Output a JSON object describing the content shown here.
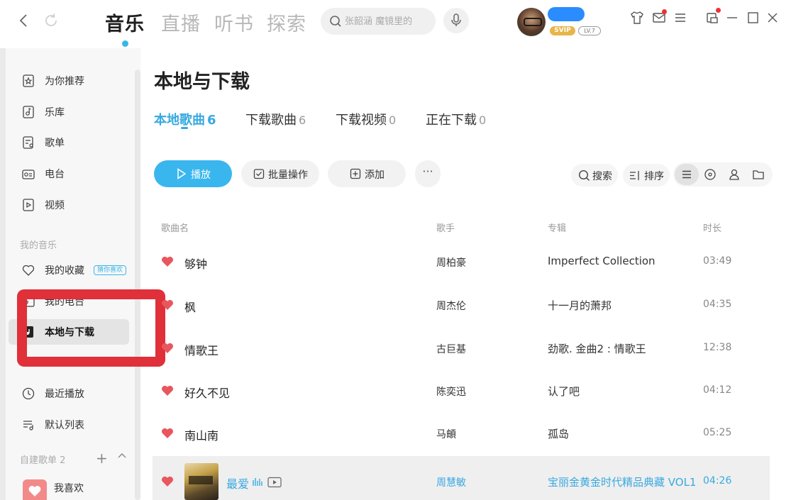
{
  "header": {
    "main_tabs": [
      {
        "label": "音乐",
        "active": true
      },
      {
        "label": "直播",
        "active": false
      },
      {
        "label": "听书",
        "active": false
      },
      {
        "label": "探索",
        "active": false
      }
    ],
    "search": {
      "placeholder": "张韶涵 魔镜里的"
    },
    "user": {
      "vip_badge": "SVIP",
      "level": "LV.7"
    }
  },
  "sidebar": {
    "online_items": [
      {
        "label": "为你推荐",
        "icon": "recommend-icon"
      },
      {
        "label": "乐库",
        "icon": "library-icon"
      },
      {
        "label": "歌单",
        "icon": "playlist-icon"
      },
      {
        "label": "电台",
        "icon": "radio-icon"
      },
      {
        "label": "视频",
        "icon": "video-icon"
      }
    ],
    "my_music_title": "我的音乐",
    "favorites": {
      "label": "我的收藏",
      "badge": "猜你喜欢"
    },
    "my_radio": {
      "label": "我的电台"
    },
    "local_download": {
      "label": "本地与下载"
    },
    "recent": {
      "label": "最近播放"
    },
    "default_list": {
      "label": "默认列表"
    },
    "created_playlists": {
      "label": "自建歌单",
      "count": "2"
    },
    "my_like": {
      "label": "我喜欢"
    }
  },
  "main": {
    "title": "本地与下载",
    "sub_tabs": [
      {
        "label": "本地歌曲",
        "count": "6",
        "active": true
      },
      {
        "label": "下载歌曲",
        "count": "6",
        "active": false
      },
      {
        "label": "下载视频",
        "count": "0",
        "active": false
      },
      {
        "label": "正在下载",
        "count": "0",
        "active": false
      }
    ],
    "actions": {
      "play": "播放",
      "batch": "批量操作",
      "add": "添加",
      "more": "···",
      "search": "搜索",
      "sort": "排序"
    },
    "columns": {
      "song": "歌曲名",
      "artist": "歌手",
      "album": "专辑",
      "duration": "时长"
    },
    "songs": [
      {
        "title": "够钟",
        "artist": "周柏豪",
        "album": "Imperfect Collection",
        "duration": "03:49"
      },
      {
        "title": "枫",
        "artist": "周杰伦",
        "album": "十一月的萧邦",
        "duration": "04:35"
      },
      {
        "title": "情歌王",
        "artist": "古巨基",
        "album": "劲歌. 金曲2 : 情歌王",
        "duration": "12:38"
      },
      {
        "title": "好久不见",
        "artist": "陈奕迅",
        "album": "认了吧",
        "duration": "04:12"
      },
      {
        "title": "南山南",
        "artist": "马頔",
        "album": "孤岛",
        "duration": "05:25"
      },
      {
        "title": "最爱",
        "artist": "周慧敏",
        "album": "宝丽金黄金时代精品典藏 VOL1",
        "duration": "04:26"
      }
    ]
  },
  "colors": {
    "accent": "#38a9e0",
    "heart": "#e8565e",
    "highlight_box": "#e0303a"
  }
}
